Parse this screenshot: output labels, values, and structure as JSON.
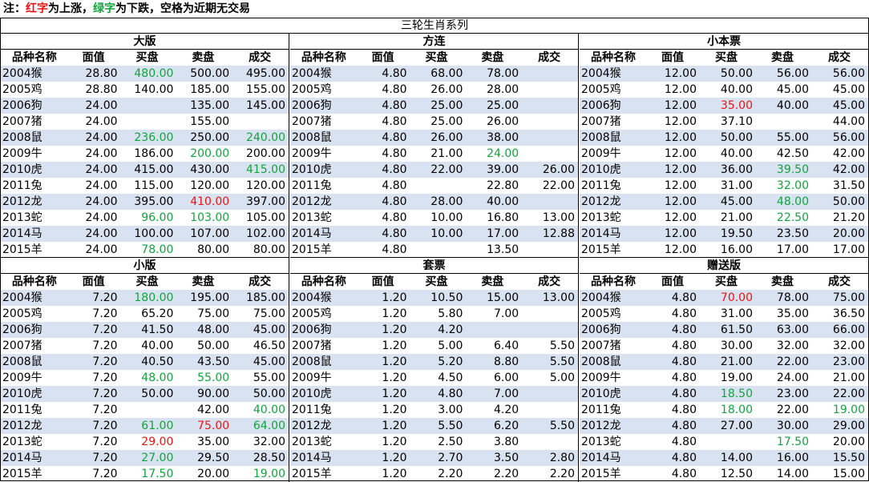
{
  "note": {
    "prefix": "注：",
    "red_word": "红字",
    "mid": "为上涨，",
    "green_word": "绿字",
    "suffix": "为下跌，空格为近期无交易"
  },
  "colors": {
    "up": "#ee1111",
    "down": "#11a43c",
    "row_shade": "#d9e2f0"
  },
  "table": {
    "title": "三轮生肖系列",
    "columns": [
      "品种名称",
      "面值",
      "买盘",
      "卖盘",
      "成交"
    ],
    "panels": [
      {
        "title": "大版",
        "rows": [
          [
            "2004猴",
            "28.80",
            {
              "v": "480.00",
              "c": "down"
            },
            "500.00",
            "495.00"
          ],
          [
            "2005鸡",
            "28.80",
            "140.00",
            "185.00",
            "155.00"
          ],
          [
            "2006狗",
            "24.00",
            "",
            "135.00",
            "145.00"
          ],
          [
            "2007猪",
            "24.00",
            "",
            "155.00",
            ""
          ],
          [
            "2008鼠",
            "24.00",
            {
              "v": "236.00",
              "c": "down"
            },
            "250.00",
            {
              "v": "240.00",
              "c": "down"
            }
          ],
          [
            "2009牛",
            "24.00",
            "186.00",
            {
              "v": "200.00",
              "c": "down"
            },
            "200.00"
          ],
          [
            "2010虎",
            "24.00",
            "415.00",
            "430.00",
            {
              "v": "415.00",
              "c": "down"
            }
          ],
          [
            "2011兔",
            "24.00",
            "115.00",
            "120.00",
            "120.00"
          ],
          [
            "2012龙",
            "24.00",
            "395.00",
            {
              "v": "410.00",
              "c": "up"
            },
            "397.00"
          ],
          [
            "2013蛇",
            "24.00",
            {
              "v": "96.00",
              "c": "down"
            },
            {
              "v": "103.00",
              "c": "down"
            },
            "105.00"
          ],
          [
            "2014马",
            "24.00",
            "100.00",
            "107.00",
            "102.00"
          ],
          [
            "2015羊",
            "24.00",
            {
              "v": "78.00",
              "c": "down"
            },
            "80.00",
            "80.00"
          ]
        ]
      },
      {
        "title": "方连",
        "rows": [
          [
            "2004猴",
            "4.80",
            "68.00",
            "78.00",
            ""
          ],
          [
            "2005鸡",
            "4.80",
            "26.00",
            "28.00",
            ""
          ],
          [
            "2006狗",
            "4.80",
            "25.00",
            "25.00",
            ""
          ],
          [
            "2007猪",
            "4.80",
            "25.00",
            "26.00",
            ""
          ],
          [
            "2008鼠",
            "4.80",
            "26.00",
            "38.00",
            ""
          ],
          [
            "2009牛",
            "4.80",
            "21.00",
            {
              "v": "24.00",
              "c": "down"
            },
            ""
          ],
          [
            "2010虎",
            "4.80",
            "22.00",
            "39.00",
            "26.00"
          ],
          [
            "2011兔",
            "4.80",
            "",
            "22.80",
            "22.00"
          ],
          [
            "2012龙",
            "4.80",
            "28.00",
            "40.00",
            ""
          ],
          [
            "2013蛇",
            "4.80",
            "10.00",
            "16.80",
            "13.00"
          ],
          [
            "2014马",
            "4.80",
            "10.00",
            "17.00",
            "12.88"
          ],
          [
            "2015羊",
            "4.80",
            "",
            "13.50",
            ""
          ]
        ]
      },
      {
        "title": "小本票",
        "rows": [
          [
            "2004猴",
            "12.00",
            "50.00",
            "56.00",
            "56.00"
          ],
          [
            "2005鸡",
            "12.00",
            "40.00",
            "45.00",
            "45.00"
          ],
          [
            "2006狗",
            "12.00",
            {
              "v": "35.00",
              "c": "up"
            },
            "40.00",
            "45.00"
          ],
          [
            "2007猪",
            "12.00",
            "37.10",
            "",
            "44.00"
          ],
          [
            "2008鼠",
            "12.00",
            "50.00",
            "55.00",
            "56.00"
          ],
          [
            "2009牛",
            "12.00",
            "40.00",
            "42.50",
            "42.00"
          ],
          [
            "2010虎",
            "12.00",
            "36.00",
            {
              "v": "39.50",
              "c": "down"
            },
            "42.00"
          ],
          [
            "2011兔",
            "12.00",
            "31.00",
            {
              "v": "32.00",
              "c": "down"
            },
            "31.50"
          ],
          [
            "2012龙",
            "12.00",
            "45.00",
            {
              "v": "48.00",
              "c": "down"
            },
            "50.00"
          ],
          [
            "2013蛇",
            "12.00",
            "21.00",
            {
              "v": "22.50",
              "c": "down"
            },
            "21.20"
          ],
          [
            "2014马",
            "12.00",
            "19.50",
            "23.50",
            "20.00"
          ],
          [
            "2015羊",
            "12.00",
            "16.00",
            "17.00",
            "17.00"
          ]
        ]
      },
      {
        "title": "小版",
        "rows": [
          [
            "2004猴",
            "7.20",
            {
              "v": "180.00",
              "c": "down"
            },
            "195.00",
            "185.00"
          ],
          [
            "2005鸡",
            "7.20",
            "65.20",
            "75.00",
            "75.00"
          ],
          [
            "2006狗",
            "7.20",
            "41.50",
            "48.00",
            "45.00"
          ],
          [
            "2007猪",
            "7.20",
            "40.00",
            "50.00",
            "46.50"
          ],
          [
            "2008鼠",
            "7.20",
            "40.50",
            "43.50",
            "45.00"
          ],
          [
            "2009牛",
            "7.20",
            {
              "v": "48.00",
              "c": "down"
            },
            {
              "v": "55.00",
              "c": "down"
            },
            "55.00"
          ],
          [
            "2010虎",
            "7.20",
            "50.00",
            "90.00",
            "50.00"
          ],
          [
            "2011兔",
            "7.20",
            "",
            "42.00",
            {
              "v": "40.00",
              "c": "down"
            }
          ],
          [
            "2012龙",
            "7.20",
            {
              "v": "61.00",
              "c": "down"
            },
            {
              "v": "75.00",
              "c": "up"
            },
            {
              "v": "64.00",
              "c": "down"
            }
          ],
          [
            "2013蛇",
            "7.20",
            {
              "v": "29.00",
              "c": "up"
            },
            "35.00",
            "32.00"
          ],
          [
            "2014马",
            "7.20",
            {
              "v": "27.00",
              "c": "down"
            },
            "29.50",
            "28.50"
          ],
          [
            "2015羊",
            "7.20",
            {
              "v": "17.50",
              "c": "down"
            },
            "20.00",
            {
              "v": "19.00",
              "c": "down"
            }
          ]
        ]
      },
      {
        "title": "套票",
        "rows": [
          [
            "2004猴",
            "1.20",
            "10.50",
            "15.00",
            "13.00"
          ],
          [
            "2005鸡",
            "1.20",
            "5.80",
            "7.00",
            ""
          ],
          [
            "2006狗",
            "1.20",
            "4.20",
            "",
            ""
          ],
          [
            "2007猪",
            "1.20",
            "5.00",
            "6.40",
            "5.50"
          ],
          [
            "2008鼠",
            "1.20",
            "5.20",
            "8.80",
            "5.50"
          ],
          [
            "2009牛",
            "1.20",
            "4.50",
            "6.00",
            "5.00"
          ],
          [
            "2010虎",
            "1.20",
            "4.80",
            "7.00",
            ""
          ],
          [
            "2011兔",
            "1.20",
            "3.00",
            "4.20",
            ""
          ],
          [
            "2012龙",
            "1.20",
            "5.50",
            "6.20",
            "5.50"
          ],
          [
            "2013蛇",
            "1.20",
            "2.50",
            "3.80",
            ""
          ],
          [
            "2014马",
            "1.20",
            "2.70",
            "3.50",
            "2.80"
          ],
          [
            "2015羊",
            "1.20",
            "2.20",
            "2.20",
            "2.20"
          ]
        ]
      },
      {
        "title": "赠送版",
        "rows": [
          [
            "2004猴",
            "4.80",
            {
              "v": "70.00",
              "c": "up"
            },
            "78.00",
            "75.00"
          ],
          [
            "2005鸡",
            "4.80",
            "31.00",
            "35.00",
            "36.50"
          ],
          [
            "2006狗",
            "4.80",
            "61.50",
            "63.00",
            "66.00"
          ],
          [
            "2007猪",
            "4.80",
            "30.00",
            "32.00",
            "32.00"
          ],
          [
            "2008鼠",
            "4.80",
            "21.00",
            "22.00",
            "23.00"
          ],
          [
            "2009牛",
            "4.80",
            "19.00",
            "24.00",
            "21.00"
          ],
          [
            "2010虎",
            "4.80",
            {
              "v": "18.50",
              "c": "down"
            },
            "23.00",
            "22.00"
          ],
          [
            "2011兔",
            "4.80",
            {
              "v": "18.00",
              "c": "down"
            },
            "22.00",
            {
              "v": "19.00",
              "c": "down"
            }
          ],
          [
            "2012龙",
            "4.80",
            "27.00",
            "30.00",
            "29.00"
          ],
          [
            "2013蛇",
            "4.80",
            "",
            {
              "v": "17.50",
              "c": "down"
            },
            "20.00"
          ],
          [
            "2014马",
            "4.80",
            "14.00",
            "16.00",
            "15.50"
          ],
          [
            "2015羊",
            "4.80",
            "12.50",
            "14.00",
            "15.00"
          ]
        ]
      }
    ]
  }
}
